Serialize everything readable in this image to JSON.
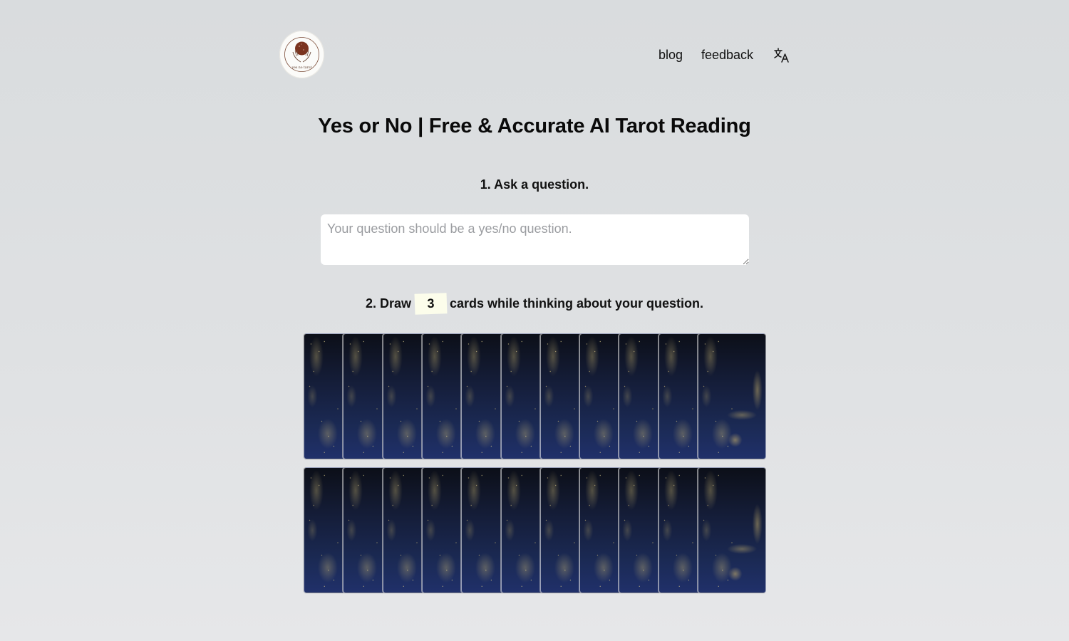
{
  "header": {
    "logo_text": "yes no tarot",
    "nav": [
      {
        "label": "blog"
      },
      {
        "label": "feedback"
      }
    ],
    "language_icon": "translate-icon"
  },
  "main": {
    "title": "Yes or No | Free & Accurate AI Tarot Reading",
    "step1": {
      "label": "1. Ask a question.",
      "question_value": "",
      "question_placeholder": "Your question should be a yes/no question."
    },
    "step2": {
      "label_before": "2. Draw",
      "draw_count": "3",
      "label_after": "cards while thinking about your question."
    },
    "deck": {
      "rows": 2,
      "cards_per_row": 11,
      "card_back": "night-sky-city-lights"
    }
  }
}
